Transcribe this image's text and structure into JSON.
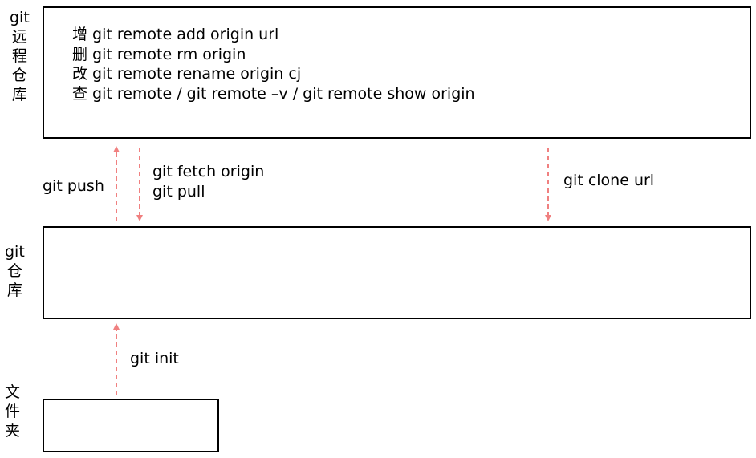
{
  "remote_repo": {
    "label_chars": [
      "git",
      "远",
      "程",
      "仓",
      "库"
    ],
    "commands": [
      {
        "verb": "增",
        "text": "git remote add origin url"
      },
      {
        "verb": "删",
        "text": "git remote rm origin"
      },
      {
        "verb": "改",
        "text": "git remote rename origin cj"
      },
      {
        "verb": "查",
        "text": "git remote / git remote –v / git remote show origin"
      }
    ]
  },
  "local_repo": {
    "label_chars": [
      "git",
      "仓",
      "库"
    ]
  },
  "folder": {
    "label_chars": [
      "文",
      "件",
      "夹"
    ]
  },
  "flows": {
    "push": "git push",
    "fetch": "git fetch origin",
    "pull": "git pull",
    "clone": "git clone url",
    "init": "git init"
  },
  "colors": {
    "arrow": "#f08080",
    "border": "#000000"
  }
}
